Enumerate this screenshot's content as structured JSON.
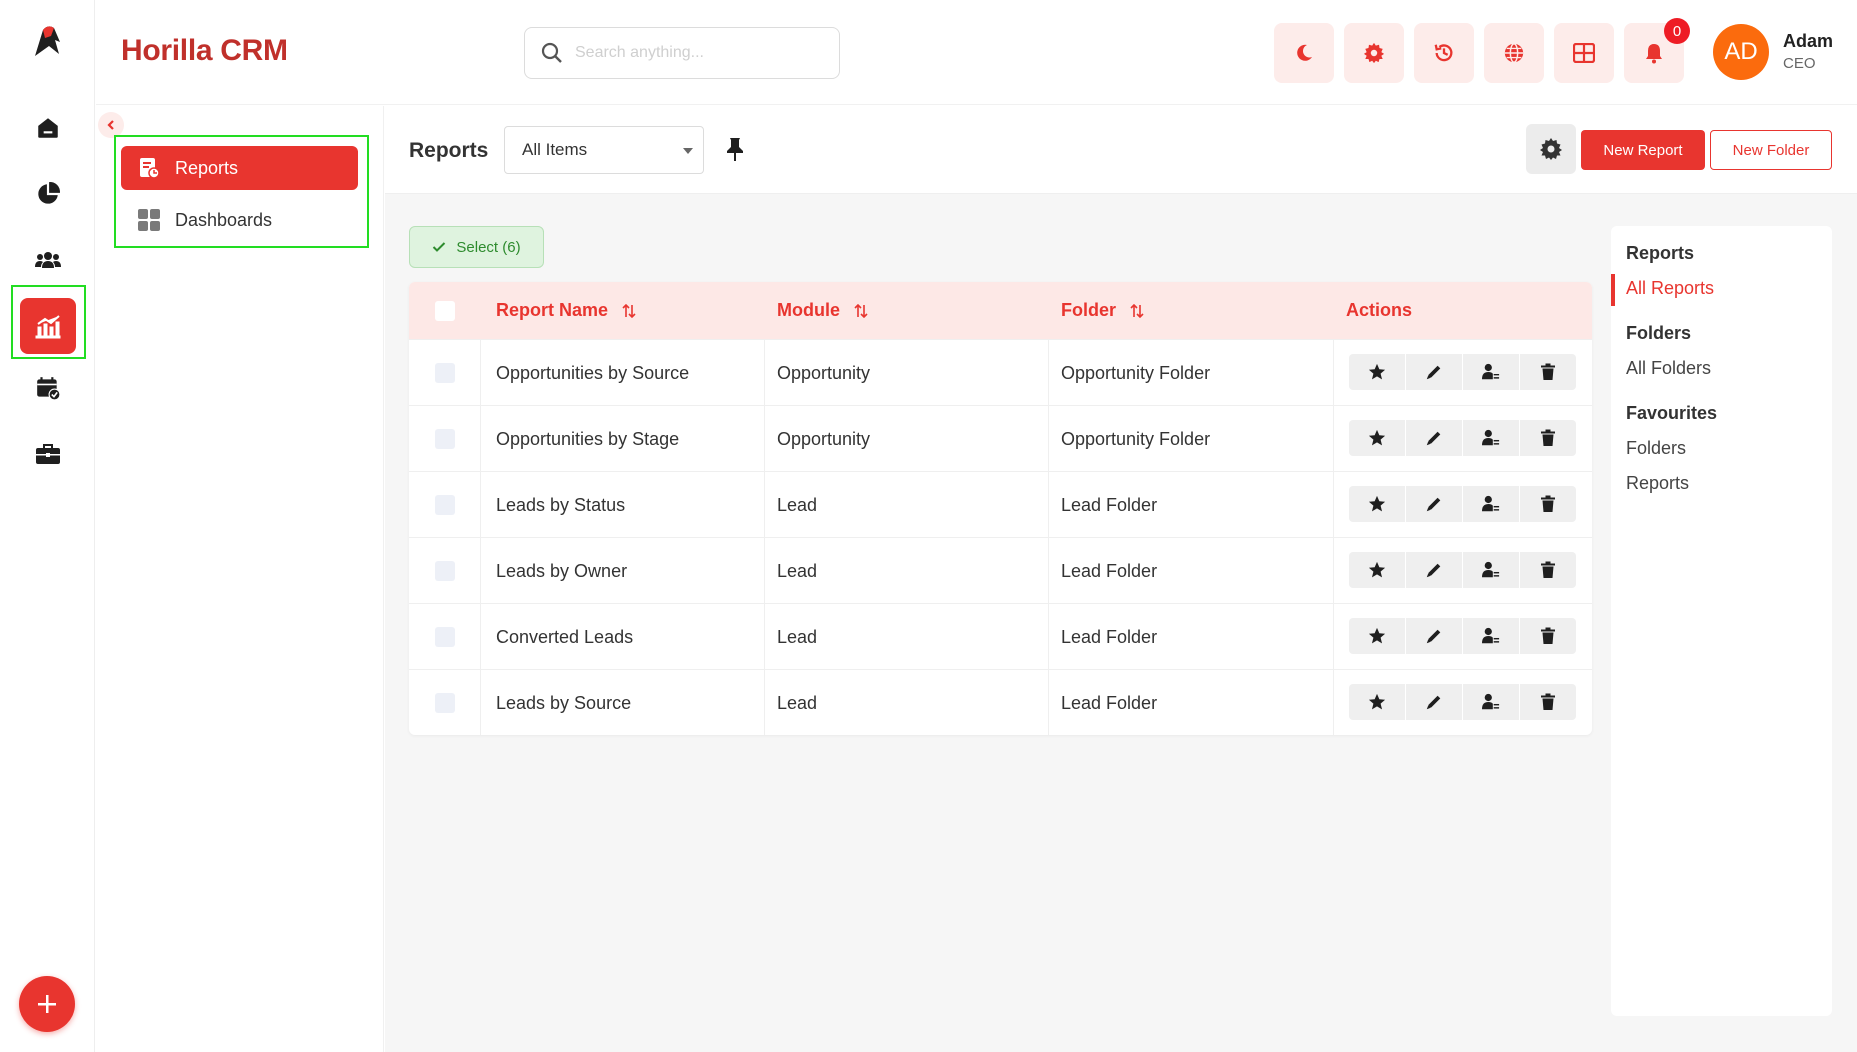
{
  "app": {
    "brand": "Horilla CRM"
  },
  "colors": {
    "accent": "#e8352f",
    "accent_soft": "#fde8e6",
    "avatar": "#fb6b0d",
    "highlight_box": "#22dd22",
    "select_green": "#2e8b2e"
  },
  "rail": {
    "icons": [
      "app-logo-icon",
      "home-icon",
      "pie-chart-icon",
      "users-icon",
      "reports-chart-icon",
      "calendar-check-icon",
      "briefcase-icon",
      "plus-icon"
    ],
    "active": "reports-chart-icon"
  },
  "header": {
    "search_placeholder": "Search anything...",
    "buttons": [
      "moon-icon",
      "gear-icon",
      "history-icon",
      "globe-icon",
      "grid-icon",
      "bell-icon"
    ],
    "notification_count": "0",
    "user": {
      "initials": "AD",
      "name": "Adam",
      "role": "CEO"
    }
  },
  "subnav": {
    "items": [
      {
        "label": "Reports",
        "icon": "report-file-icon",
        "active": true
      },
      {
        "label": "Dashboards",
        "icon": "dashboard-grid-icon",
        "active": false
      }
    ]
  },
  "toolbar": {
    "title": "Reports",
    "view_selected": "All Items",
    "new_report_label": "New Report",
    "new_folder_label": "New Folder"
  },
  "select_button": {
    "label": "Select (6)"
  },
  "table": {
    "columns": [
      "Report Name",
      "Module",
      "Folder",
      "Actions"
    ],
    "rows": [
      {
        "name": "Opportunities by Source",
        "module": "Opportunity",
        "folder": "Opportunity Folder"
      },
      {
        "name": "Opportunities by Stage",
        "module": "Opportunity",
        "folder": "Opportunity Folder"
      },
      {
        "name": "Leads by Status",
        "module": "Lead",
        "folder": "Lead Folder"
      },
      {
        "name": "Leads by Owner",
        "module": "Lead",
        "folder": "Lead Folder"
      },
      {
        "name": "Converted Leads",
        "module": "Lead",
        "folder": "Lead Folder"
      },
      {
        "name": "Leads by Source",
        "module": "Lead",
        "folder": "Lead Folder"
      }
    ],
    "row_actions": [
      "star-icon",
      "pencil-icon",
      "user-share-icon",
      "trash-icon"
    ]
  },
  "right_panel": {
    "reports_heading": "Reports",
    "all_reports": "All Reports",
    "folders_heading": "Folders",
    "all_folders": "All Folders",
    "favourites_heading": "Favourites",
    "fav_folders": "Folders",
    "fav_reports": "Reports"
  }
}
